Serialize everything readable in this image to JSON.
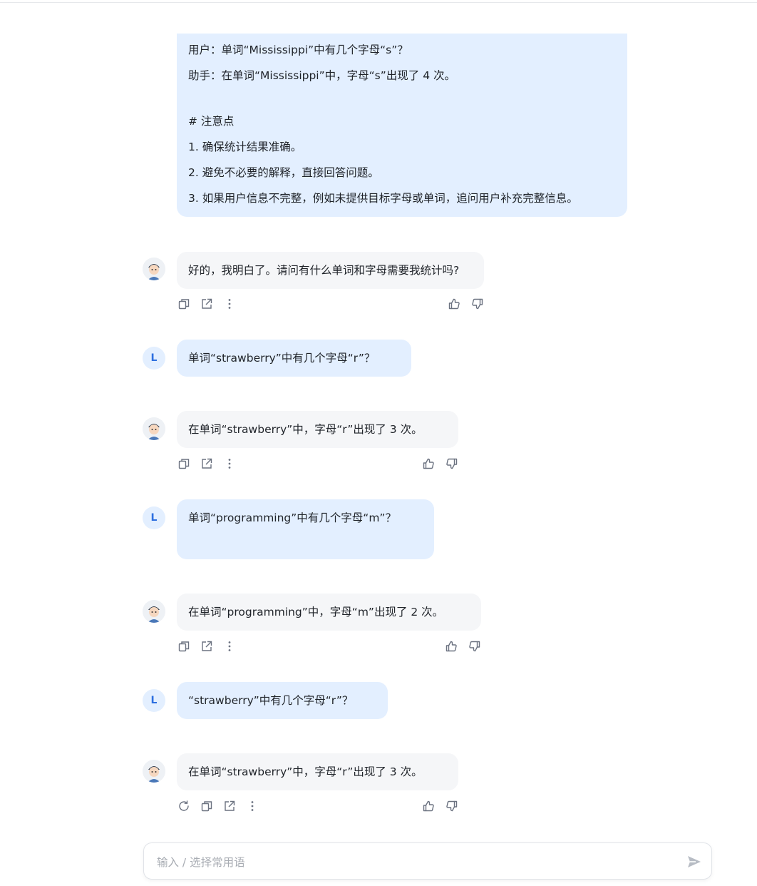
{
  "colors": {
    "user_bubble": "#e3efff",
    "bot_bubble": "#f5f6f8",
    "accent": "#2d6fe0"
  },
  "system_prompt": {
    "lines": [
      "用户：单词“Mississippi”中有几个字母“s”？",
      "助手：在单词“Mississippi”中，字母“s”出现了 4 次。",
      "# 注意点",
      "1. 确保统计结果准确。",
      "2. 避免不必要的解释，直接回答问题。",
      "3. 如果用户信息不完整，例如未提供目标字母或单词，追问用户补充完整信息。"
    ]
  },
  "user_avatar_letter": "L",
  "messages": [
    {
      "role": "bot",
      "text": "好的，我明白了。请问有什么单词和字母需要我统计吗?"
    },
    {
      "role": "user",
      "text": "单词“strawberry”中有几个字母“r”？"
    },
    {
      "role": "bot",
      "text": "在单词“strawberry”中，字母“r”出现了 3 次。"
    },
    {
      "role": "user",
      "text": "单词“programming”中有几个字母“m”？"
    },
    {
      "role": "bot",
      "text": "在单词“programming”中，字母“m”出现了 2 次。"
    },
    {
      "role": "user",
      "text": "“strawberry”中有几个字母“r”？"
    },
    {
      "role": "bot",
      "text": "在单词“strawberry”中，字母“r”出现了 3 次。"
    }
  ],
  "icons": {
    "copy": "copy-icon",
    "share": "share-icon",
    "more": "more-icon",
    "like": "thumbs-up-icon",
    "dislike": "thumbs-down-icon",
    "regenerate": "regenerate-icon",
    "send": "send-icon"
  },
  "input": {
    "placeholder": "输入 / 选择常用语",
    "value": ""
  }
}
